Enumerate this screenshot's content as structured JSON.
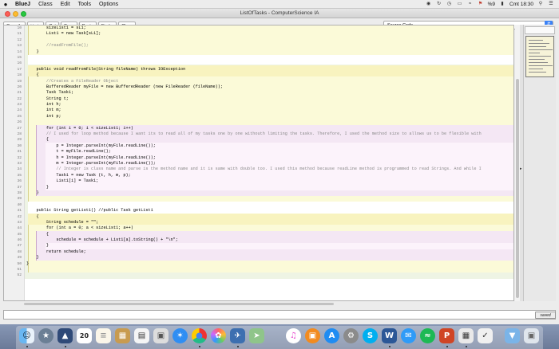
{
  "menubar": {
    "apple": "",
    "items": [
      "BlueJ",
      "Class",
      "Edit",
      "Tools",
      "Options"
    ],
    "battery": "%9",
    "clock": "Cmt 18:30"
  },
  "window": {
    "title": "ListOfTasks - ComputerScience IA"
  },
  "toolbar": {
    "compile": "Compile",
    "undo": "Undo",
    "cut": "Cut",
    "copy": "Copy",
    "paste": "Paste",
    "find": "Find...",
    "close": "Close",
    "view_select": "Source Code"
  },
  "code_lines": [
    {
      "n": "10",
      "t": "        sizeList1 = sL1;"
    },
    {
      "n": "11",
      "t": "        List1 = new Task[sL1];"
    },
    {
      "n": "12",
      "t": ""
    },
    {
      "n": "13",
      "t": "        //readFromFile();"
    },
    {
      "n": "14",
      "t": "    }"
    },
    {
      "n": "15",
      "t": ""
    },
    {
      "n": "16",
      "t": ""
    },
    {
      "n": "17",
      "t": "    public void readFromFile(String fileName) throws IOException"
    },
    {
      "n": "18",
      "t": "    {"
    },
    {
      "n": "19",
      "t": "        //Creates a FileReader Object"
    },
    {
      "n": "20",
      "t": "        BufferedReader myFile = new BufferedReader (new FileReader (fileName));"
    },
    {
      "n": "21",
      "t": "        Task Task1;"
    },
    {
      "n": "22",
      "t": "        String t;"
    },
    {
      "n": "23",
      "t": "        int h;"
    },
    {
      "n": "24",
      "t": "        int m;"
    },
    {
      "n": "25",
      "t": "        int p;"
    },
    {
      "n": "26",
      "t": ""
    },
    {
      "n": "27",
      "t": "        for (int i = 0; i < sizeList1; i++)"
    },
    {
      "n": "28",
      "t": "        // I used for loop method because I want its to read all of my tasks one by one withouth limiting the tasks. Therefore, I used the method size to allows us to be flexible with"
    },
    {
      "n": "29",
      "t": "        {"
    },
    {
      "n": "30",
      "t": "            p = Integer.parseInt(myFile.readLine());"
    },
    {
      "n": "31",
      "t": "            t = myFile.readLine();"
    },
    {
      "n": "32",
      "t": "            h = Integer.parseInt(myFile.readLine());"
    },
    {
      "n": "33",
      "t": "            m = Integer.parseInt(myFile.readLine());"
    },
    {
      "n": "34",
      "t": "            // Integer is class name and parse is the method name and it is same with double too. I used this method because readLine method is programmed to read Strings. And while I"
    },
    {
      "n": "35",
      "t": "            Task1 = new Task (t, h, m, p);"
    },
    {
      "n": "36",
      "t": "            List1[i] = Task1;"
    },
    {
      "n": "37",
      "t": "        }"
    },
    {
      "n": "38",
      "t": "    }"
    },
    {
      "n": "39",
      "t": ""
    },
    {
      "n": "40",
      "t": ""
    },
    {
      "n": "41",
      "t": "    public String getList1() //public Task getList1"
    },
    {
      "n": "42",
      "t": "    {"
    },
    {
      "n": "43",
      "t": "        String schedule = \"\";"
    },
    {
      "n": "44",
      "t": "        for (int a = 0; a < sizeList1; a++)"
    },
    {
      "n": "45",
      "t": "        {"
    },
    {
      "n": "46",
      "t": "            schedule = schedule + List1[a].toString() + \"\\n\";"
    },
    {
      "n": "47",
      "t": "        }"
    },
    {
      "n": "48",
      "t": "        return schedule;"
    },
    {
      "n": "49",
      "t": "    }"
    },
    {
      "n": "50",
      "t": "}"
    },
    {
      "n": "51",
      "t": ""
    },
    {
      "n": "52",
      "t": ""
    }
  ],
  "status": {
    "message": "",
    "saved": "saved"
  },
  "dock": {
    "calendar_day": "20",
    "apps": [
      "finder-icon",
      "launchpad-icon",
      "photo-icon",
      "calendar-icon",
      "notes-icon",
      "stickies-icon",
      "book-icon",
      "preview-icon",
      "safari-icon",
      "chrome-icon",
      "photos-icon",
      "bluej-icon",
      "maps-icon",
      "itunes-icon",
      "books-icon",
      "appstore-icon",
      "settings-icon",
      "skype-icon",
      "word-icon",
      "messages-icon",
      "spotify-icon",
      "powerpoint-icon",
      "bluej-class-icon",
      "tex-icon",
      "downloads-icon",
      "trash-icon"
    ]
  }
}
